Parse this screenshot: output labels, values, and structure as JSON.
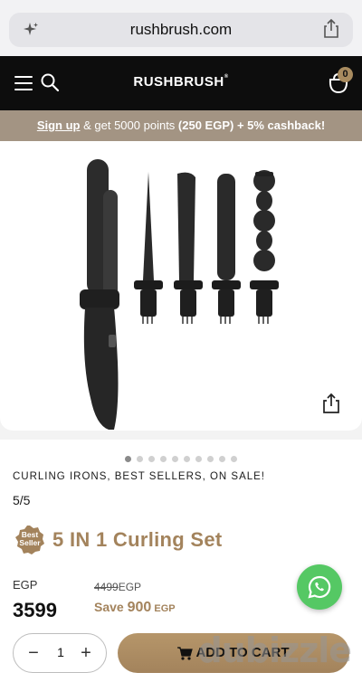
{
  "browser": {
    "domain": "rushbrush.com"
  },
  "header": {
    "logo": "RUSHBRUSH",
    "logo_mark": "®",
    "cart_count": "0"
  },
  "promo": {
    "signup": "Sign up",
    "text_mid": " & get 5000 points ",
    "bold": "(250 EGP) + 5% cashback!"
  },
  "gallery": {
    "total_images": 10,
    "active_index": 0
  },
  "product": {
    "categories": "CURLING IRONS,  BEST SELLERS,  ON SALE!",
    "rating": "5/5",
    "badge_line1": "Best",
    "badge_line2": "Seller",
    "title": "5 IN 1 Curling Set",
    "currency": "EGP",
    "price": "3599",
    "old_price": "4499",
    "old_currency": "EGP",
    "save_label": "Save ",
    "save_amount": "900",
    "save_currency": " EGP"
  },
  "cart": {
    "minus": "−",
    "quantity": "1",
    "plus": "+",
    "add_label": "ADD TO CART"
  },
  "watermark": "dubizzle",
  "colors": {
    "header_bg": "#0d0d0d",
    "promo_bg": "#a39483",
    "accent_gold": "#a3835c",
    "whatsapp_green": "#55c864"
  }
}
